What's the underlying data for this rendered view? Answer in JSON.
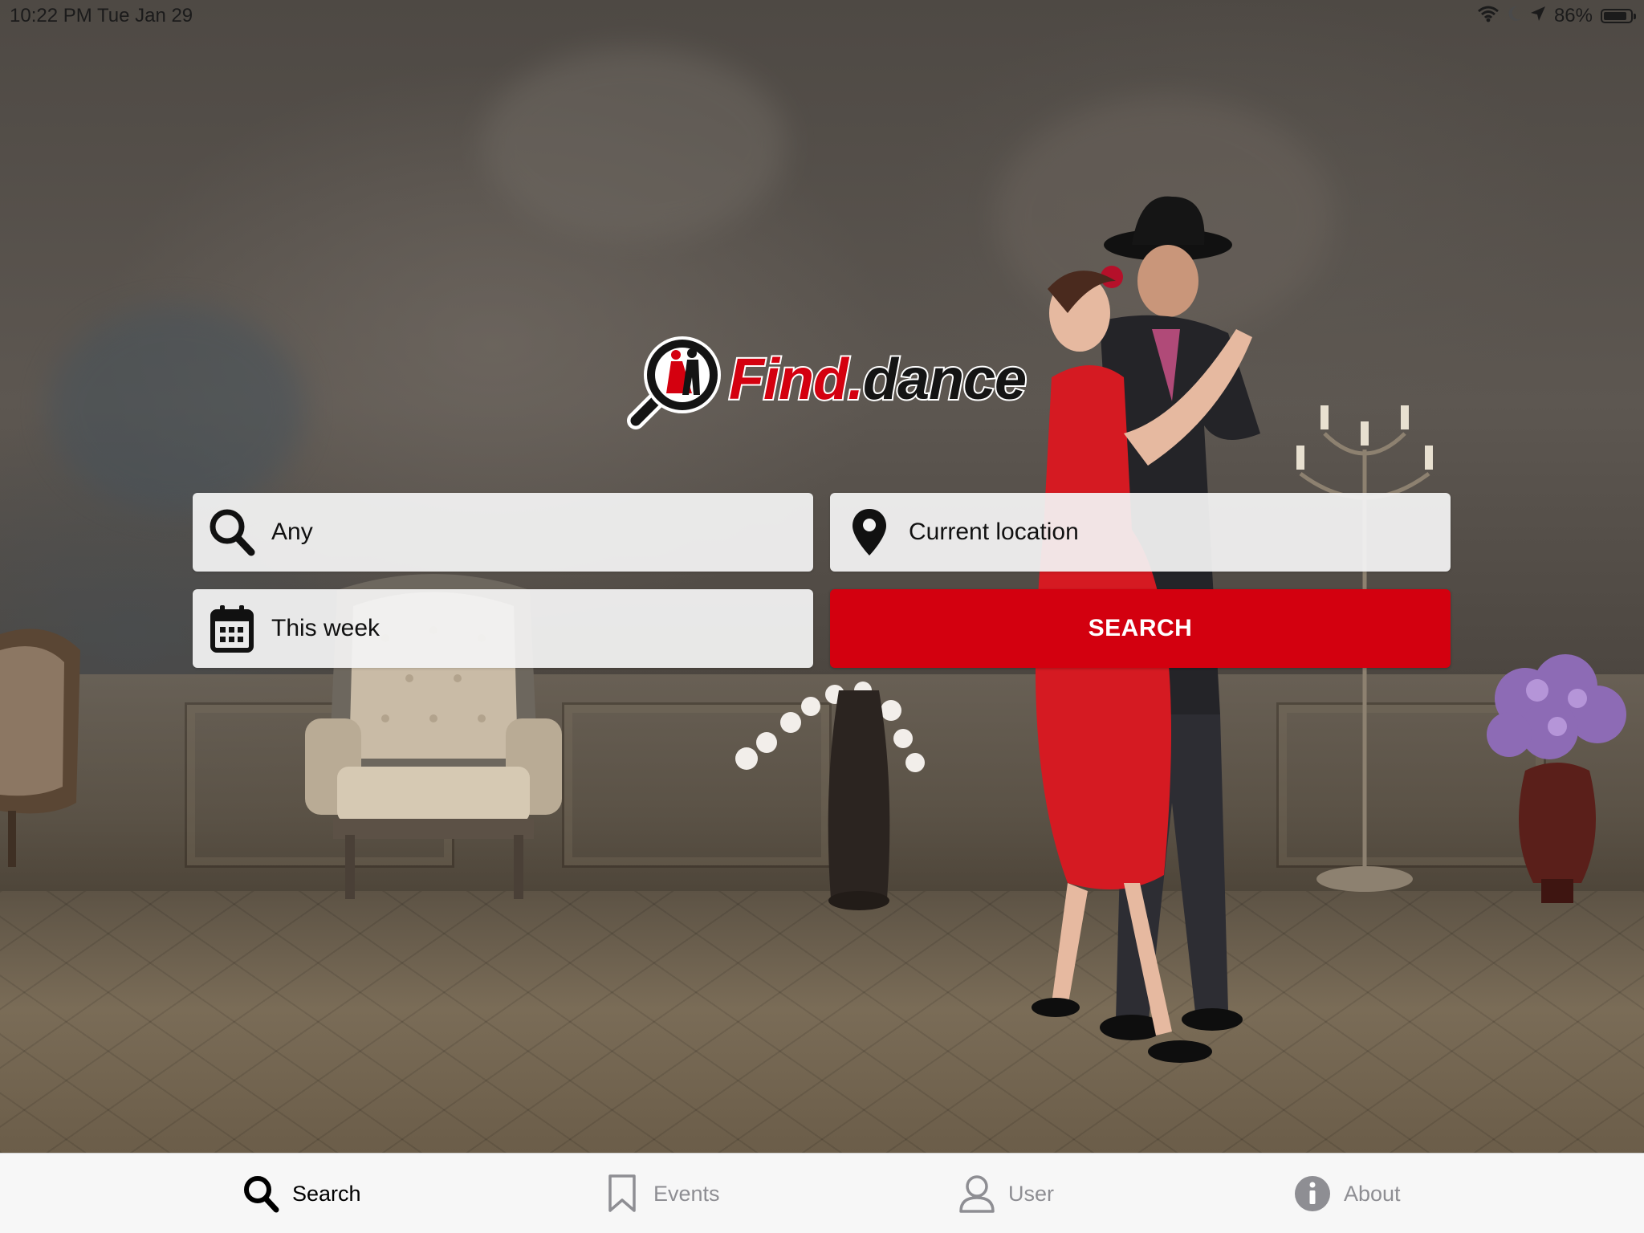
{
  "status_bar": {
    "time_date": "10:22 PM   Tue Jan 29",
    "battery_text": "86%",
    "battery_level": 0.86,
    "wifi_icon": "wifi-icon",
    "moon_icon": "moon-icon",
    "location_icon": "location-arrow-icon"
  },
  "logo": {
    "find": "Find",
    "dot": ".",
    "dance": "dance",
    "colors": {
      "red": "#d4000f",
      "dark": "#141414"
    }
  },
  "search_form": {
    "what": {
      "value": "Any",
      "icon": "search-icon"
    },
    "where": {
      "value": "Current location",
      "icon": "map-pin-icon"
    },
    "when": {
      "value": "This week",
      "icon": "calendar-icon"
    },
    "search_button_label": "SEARCH",
    "accent_color": "#d3000f"
  },
  "tab_bar": {
    "tabs": [
      {
        "label": "Search",
        "icon": "search-icon",
        "active": true
      },
      {
        "label": "Events",
        "icon": "bookmark-icon",
        "active": false
      },
      {
        "label": "User",
        "icon": "user-icon",
        "active": false
      },
      {
        "label": "About",
        "icon": "info-icon",
        "active": false
      }
    ],
    "active_color": "#000000",
    "inactive_color": "#8e8e93"
  }
}
